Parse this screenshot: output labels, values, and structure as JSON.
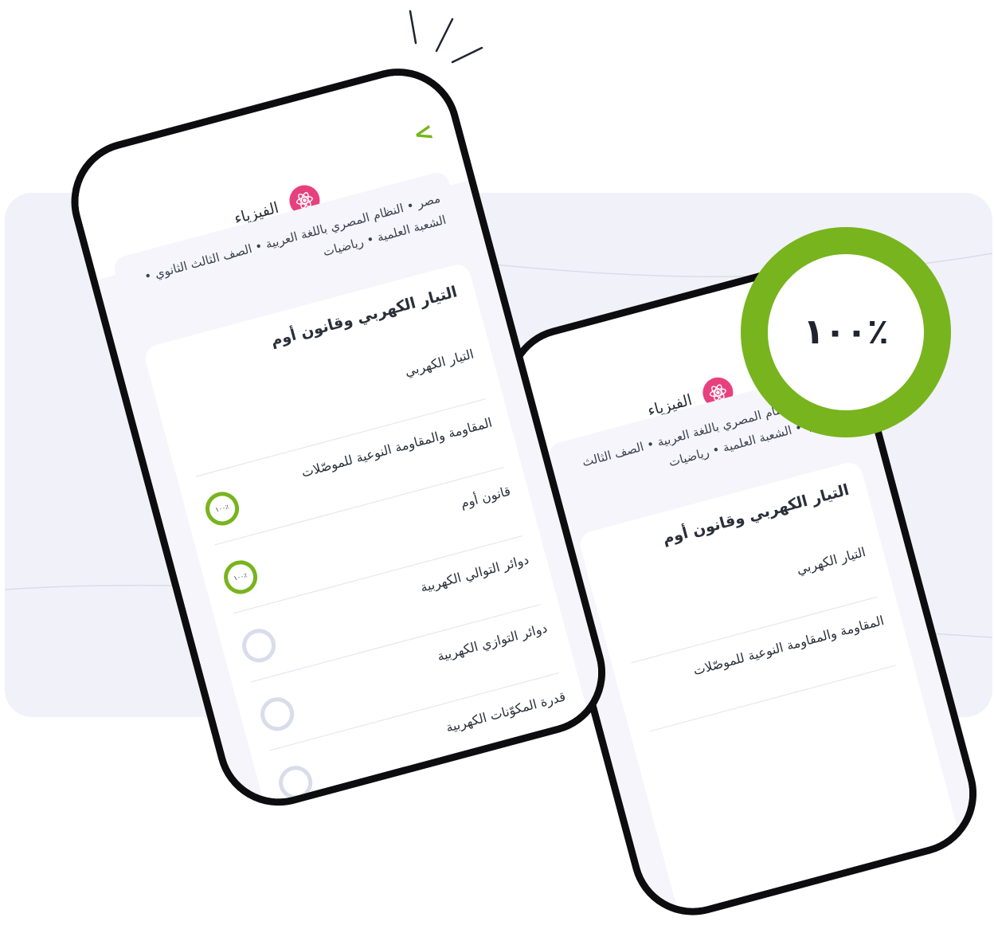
{
  "badge": {
    "label": "١٠٠٪"
  },
  "colors": {
    "accent": "#78b41e",
    "subject": "#e8407e",
    "background": "#f1f1f9"
  },
  "front_phone": {
    "subject": "الفيزياء",
    "path": "مصر • النظام المصري باللغة العربية • الصف الثالث الثانوي • الشعبة العلمية • رياضيات",
    "unit_title": "التيار الكهربي وقانون أوم",
    "lessons": [
      {
        "label": "التيار الكهربي",
        "progress": null,
        "progress_label": ""
      },
      {
        "label": "المقاومة والمقاومة النوعية للموصّلات",
        "progress": 1.0,
        "progress_label": "١٠٠٪"
      },
      {
        "label": "قانون أوم",
        "progress": 1.0,
        "progress_label": "١٠٠٪"
      },
      {
        "label": "دوائر التوالي الكهربية",
        "progress": 0,
        "progress_label": ""
      },
      {
        "label": "دوائر التوازي الكهربية",
        "progress": 0,
        "progress_label": ""
      },
      {
        "label": "قدرة المكوّنات الكهربية",
        "progress": 0,
        "progress_label": ""
      }
    ]
  },
  "back_phone": {
    "subject": "الفيزياء",
    "path": "مصر • النظام المصري باللغة العربية • الصف الثالث الثانوي • الشعبة العلمية • رياضيات",
    "unit_title": "التيار الكهربي وقانون أوم",
    "lessons": [
      {
        "label": "التيار الكهربي"
      },
      {
        "label": "المقاومة والمقاومة النوعية للموصّلات"
      }
    ]
  }
}
